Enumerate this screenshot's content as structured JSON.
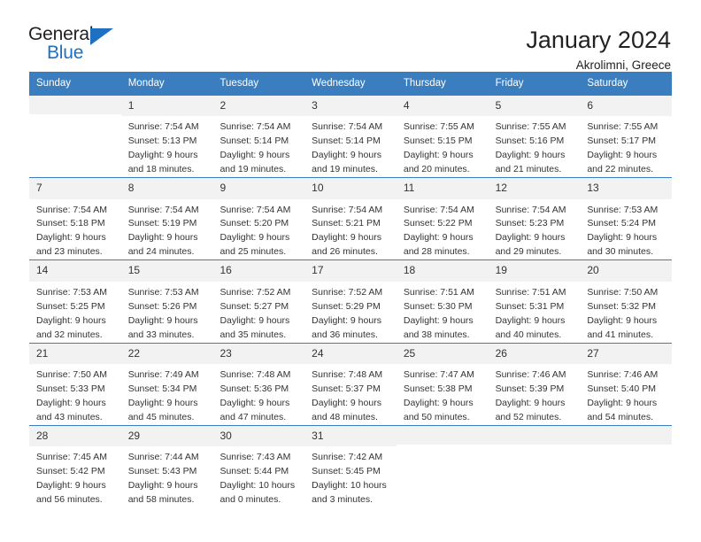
{
  "brand": {
    "name_top": "General",
    "name_bottom": "Blue",
    "accent_color": "#1f70c1"
  },
  "header": {
    "title": "January 2024",
    "subtitle": "Akrolimni, Greece"
  },
  "calendar": {
    "header_bg": "#3a7ebf",
    "day_number_bg": "#f2f2f2",
    "weekdays": [
      "Sunday",
      "Monday",
      "Tuesday",
      "Wednesday",
      "Thursday",
      "Friday",
      "Saturday"
    ],
    "weeks": [
      [
        {
          "day": "",
          "empty": true,
          "sunrise": "",
          "sunset": "",
          "daylight_line1": "",
          "daylight_line2": ""
        },
        {
          "day": "1",
          "empty": false,
          "sunrise": "Sunrise: 7:54 AM",
          "sunset": "Sunset: 5:13 PM",
          "daylight_line1": "Daylight: 9 hours",
          "daylight_line2": "and 18 minutes."
        },
        {
          "day": "2",
          "empty": false,
          "sunrise": "Sunrise: 7:54 AM",
          "sunset": "Sunset: 5:14 PM",
          "daylight_line1": "Daylight: 9 hours",
          "daylight_line2": "and 19 minutes."
        },
        {
          "day": "3",
          "empty": false,
          "sunrise": "Sunrise: 7:54 AM",
          "sunset": "Sunset: 5:14 PM",
          "daylight_line1": "Daylight: 9 hours",
          "daylight_line2": "and 19 minutes."
        },
        {
          "day": "4",
          "empty": false,
          "sunrise": "Sunrise: 7:55 AM",
          "sunset": "Sunset: 5:15 PM",
          "daylight_line1": "Daylight: 9 hours",
          "daylight_line2": "and 20 minutes."
        },
        {
          "day": "5",
          "empty": false,
          "sunrise": "Sunrise: 7:55 AM",
          "sunset": "Sunset: 5:16 PM",
          "daylight_line1": "Daylight: 9 hours",
          "daylight_line2": "and 21 minutes."
        },
        {
          "day": "6",
          "empty": false,
          "sunrise": "Sunrise: 7:55 AM",
          "sunset": "Sunset: 5:17 PM",
          "daylight_line1": "Daylight: 9 hours",
          "daylight_line2": "and 22 minutes."
        }
      ],
      [
        {
          "day": "7",
          "empty": false,
          "sunrise": "Sunrise: 7:54 AM",
          "sunset": "Sunset: 5:18 PM",
          "daylight_line1": "Daylight: 9 hours",
          "daylight_line2": "and 23 minutes."
        },
        {
          "day": "8",
          "empty": false,
          "sunrise": "Sunrise: 7:54 AM",
          "sunset": "Sunset: 5:19 PM",
          "daylight_line1": "Daylight: 9 hours",
          "daylight_line2": "and 24 minutes."
        },
        {
          "day": "9",
          "empty": false,
          "sunrise": "Sunrise: 7:54 AM",
          "sunset": "Sunset: 5:20 PM",
          "daylight_line1": "Daylight: 9 hours",
          "daylight_line2": "and 25 minutes."
        },
        {
          "day": "10",
          "empty": false,
          "sunrise": "Sunrise: 7:54 AM",
          "sunset": "Sunset: 5:21 PM",
          "daylight_line1": "Daylight: 9 hours",
          "daylight_line2": "and 26 minutes."
        },
        {
          "day": "11",
          "empty": false,
          "sunrise": "Sunrise: 7:54 AM",
          "sunset": "Sunset: 5:22 PM",
          "daylight_line1": "Daylight: 9 hours",
          "daylight_line2": "and 28 minutes."
        },
        {
          "day": "12",
          "empty": false,
          "sunrise": "Sunrise: 7:54 AM",
          "sunset": "Sunset: 5:23 PM",
          "daylight_line1": "Daylight: 9 hours",
          "daylight_line2": "and 29 minutes."
        },
        {
          "day": "13",
          "empty": false,
          "sunrise": "Sunrise: 7:53 AM",
          "sunset": "Sunset: 5:24 PM",
          "daylight_line1": "Daylight: 9 hours",
          "daylight_line2": "and 30 minutes."
        }
      ],
      [
        {
          "day": "14",
          "empty": false,
          "sunrise": "Sunrise: 7:53 AM",
          "sunset": "Sunset: 5:25 PM",
          "daylight_line1": "Daylight: 9 hours",
          "daylight_line2": "and 32 minutes."
        },
        {
          "day": "15",
          "empty": false,
          "sunrise": "Sunrise: 7:53 AM",
          "sunset": "Sunset: 5:26 PM",
          "daylight_line1": "Daylight: 9 hours",
          "daylight_line2": "and 33 minutes."
        },
        {
          "day": "16",
          "empty": false,
          "sunrise": "Sunrise: 7:52 AM",
          "sunset": "Sunset: 5:27 PM",
          "daylight_line1": "Daylight: 9 hours",
          "daylight_line2": "and 35 minutes."
        },
        {
          "day": "17",
          "empty": false,
          "sunrise": "Sunrise: 7:52 AM",
          "sunset": "Sunset: 5:29 PM",
          "daylight_line1": "Daylight: 9 hours",
          "daylight_line2": "and 36 minutes."
        },
        {
          "day": "18",
          "empty": false,
          "sunrise": "Sunrise: 7:51 AM",
          "sunset": "Sunset: 5:30 PM",
          "daylight_line1": "Daylight: 9 hours",
          "daylight_line2": "and 38 minutes."
        },
        {
          "day": "19",
          "empty": false,
          "sunrise": "Sunrise: 7:51 AM",
          "sunset": "Sunset: 5:31 PM",
          "daylight_line1": "Daylight: 9 hours",
          "daylight_line2": "and 40 minutes."
        },
        {
          "day": "20",
          "empty": false,
          "sunrise": "Sunrise: 7:50 AM",
          "sunset": "Sunset: 5:32 PM",
          "daylight_line1": "Daylight: 9 hours",
          "daylight_line2": "and 41 minutes."
        }
      ],
      [
        {
          "day": "21",
          "empty": false,
          "sunrise": "Sunrise: 7:50 AM",
          "sunset": "Sunset: 5:33 PM",
          "daylight_line1": "Daylight: 9 hours",
          "daylight_line2": "and 43 minutes."
        },
        {
          "day": "22",
          "empty": false,
          "sunrise": "Sunrise: 7:49 AM",
          "sunset": "Sunset: 5:34 PM",
          "daylight_line1": "Daylight: 9 hours",
          "daylight_line2": "and 45 minutes."
        },
        {
          "day": "23",
          "empty": false,
          "sunrise": "Sunrise: 7:48 AM",
          "sunset": "Sunset: 5:36 PM",
          "daylight_line1": "Daylight: 9 hours",
          "daylight_line2": "and 47 minutes."
        },
        {
          "day": "24",
          "empty": false,
          "sunrise": "Sunrise: 7:48 AM",
          "sunset": "Sunset: 5:37 PM",
          "daylight_line1": "Daylight: 9 hours",
          "daylight_line2": "and 48 minutes."
        },
        {
          "day": "25",
          "empty": false,
          "sunrise": "Sunrise: 7:47 AM",
          "sunset": "Sunset: 5:38 PM",
          "daylight_line1": "Daylight: 9 hours",
          "daylight_line2": "and 50 minutes."
        },
        {
          "day": "26",
          "empty": false,
          "sunrise": "Sunrise: 7:46 AM",
          "sunset": "Sunset: 5:39 PM",
          "daylight_line1": "Daylight: 9 hours",
          "daylight_line2": "and 52 minutes."
        },
        {
          "day": "27",
          "empty": false,
          "sunrise": "Sunrise: 7:46 AM",
          "sunset": "Sunset: 5:40 PM",
          "daylight_line1": "Daylight: 9 hours",
          "daylight_line2": "and 54 minutes."
        }
      ],
      [
        {
          "day": "28",
          "empty": false,
          "sunrise": "Sunrise: 7:45 AM",
          "sunset": "Sunset: 5:42 PM",
          "daylight_line1": "Daylight: 9 hours",
          "daylight_line2": "and 56 minutes."
        },
        {
          "day": "29",
          "empty": false,
          "sunrise": "Sunrise: 7:44 AM",
          "sunset": "Sunset: 5:43 PM",
          "daylight_line1": "Daylight: 9 hours",
          "daylight_line2": "and 58 minutes."
        },
        {
          "day": "30",
          "empty": false,
          "sunrise": "Sunrise: 7:43 AM",
          "sunset": "Sunset: 5:44 PM",
          "daylight_line1": "Daylight: 10 hours",
          "daylight_line2": "and 0 minutes."
        },
        {
          "day": "31",
          "empty": false,
          "sunrise": "Sunrise: 7:42 AM",
          "sunset": "Sunset: 5:45 PM",
          "daylight_line1": "Daylight: 10 hours",
          "daylight_line2": "and 3 minutes."
        },
        {
          "day": "",
          "empty": true,
          "sunrise": "",
          "sunset": "",
          "daylight_line1": "",
          "daylight_line2": ""
        },
        {
          "day": "",
          "empty": true,
          "sunrise": "",
          "sunset": "",
          "daylight_line1": "",
          "daylight_line2": ""
        },
        {
          "day": "",
          "empty": true,
          "sunrise": "",
          "sunset": "",
          "daylight_line1": "",
          "daylight_line2": ""
        }
      ]
    ]
  }
}
